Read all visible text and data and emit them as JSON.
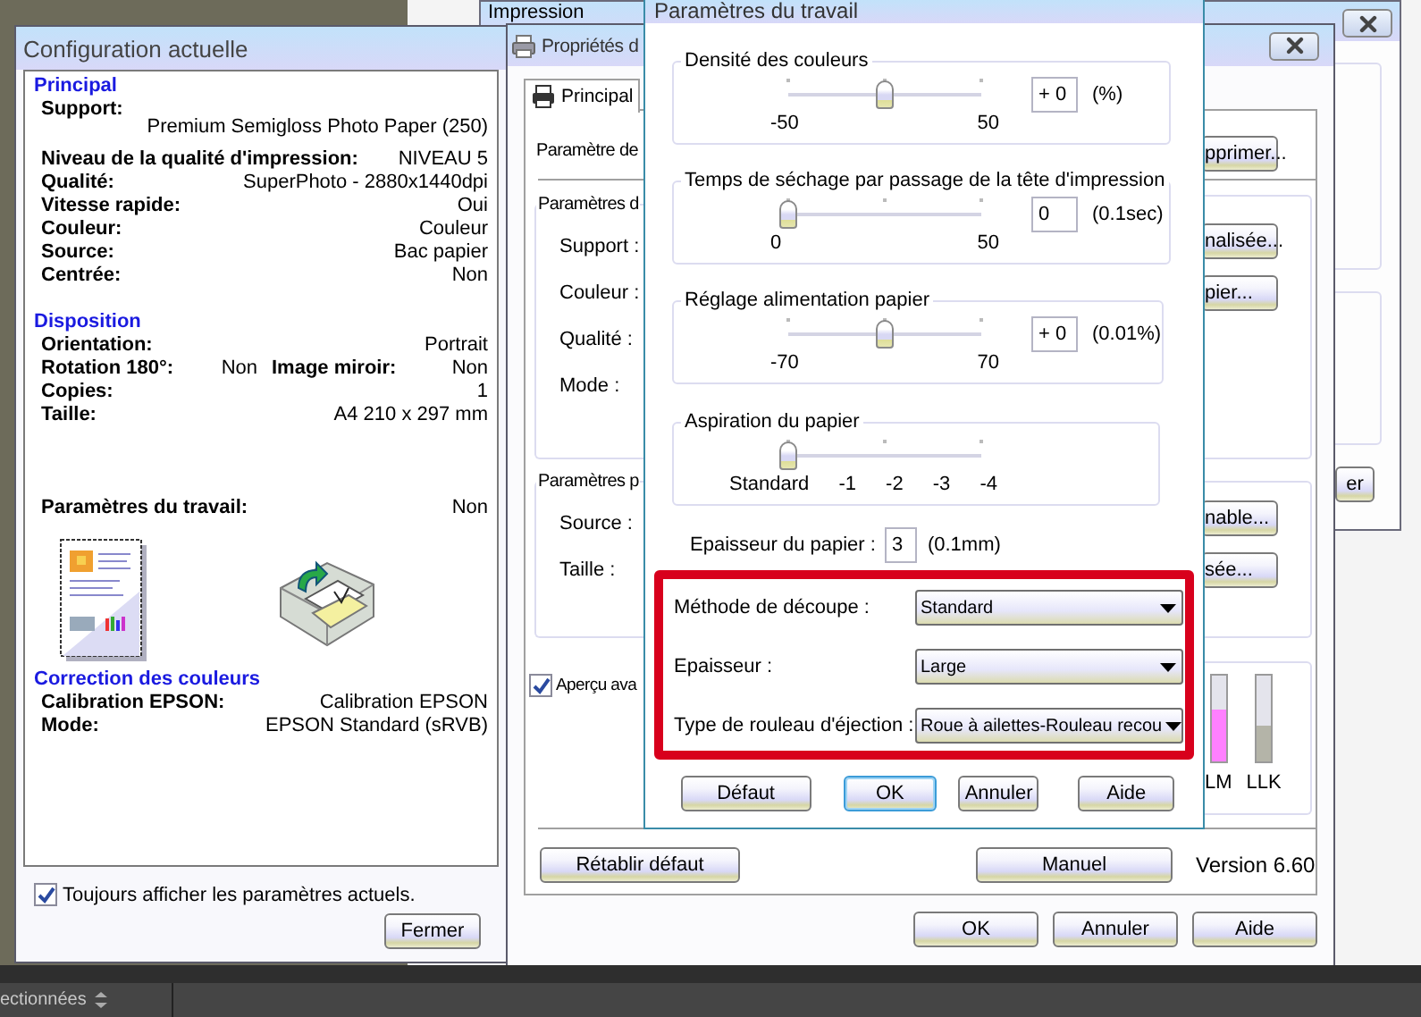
{
  "impression_window": {
    "title": "Impression",
    "button": "er"
  },
  "properties_window": {
    "title": "Propriétés d",
    "tabs": [
      {
        "label": "Principal",
        "selected": true
      }
    ],
    "heading": "Paramètre de",
    "groups": [
      {
        "title": "Paramètres d",
        "fields": [
          "Support :",
          "Couleur :",
          "Qualité :",
          "Mode :"
        ]
      },
      {
        "title": "Paramètres p",
        "fields": [
          "Source :",
          "Taille :"
        ]
      }
    ],
    "top_button": "pprimer...",
    "side_groups": [
      {
        "buttons": [
          "nalisée...",
          "pier..."
        ]
      },
      {
        "buttons": [
          "nable...",
          "sée..."
        ]
      }
    ],
    "preview_checkbox": {
      "label": "Aperçu ava",
      "checked": true
    },
    "ink_levels": [
      {
        "name": "LM",
        "color": "#ff80ff",
        "level": 0.6
      },
      {
        "name": "LLK",
        "color": "#b4b4a8",
        "level": 0.42
      }
    ],
    "reset_button": "Rétablir défaut",
    "manual_button": "Manuel",
    "version": "Version 6.60",
    "buttons": [
      "OK",
      "Annuler",
      "Aide"
    ]
  },
  "config_window": {
    "title": "Configuration actuelle",
    "blocks": [
      {
        "kind": "section",
        "heading": "Principal",
        "rows": [
          {
            "kind": "stacked",
            "label": "Support:",
            "line_2": "Premium Semigloss Photo Paper (250)"
          },
          {
            "kind": "inline",
            "label": "Niveau de la qualité d'impression:",
            "value": "NIVEAU 5"
          },
          {
            "kind": "inline",
            "label": "Qualité:",
            "value": "SuperPhoto - 2880x1440dpi"
          },
          {
            "kind": "inline",
            "label": "Vitesse rapide:",
            "value": "Oui"
          },
          {
            "kind": "inline",
            "label": "Couleur:",
            "value": "Couleur"
          },
          {
            "kind": "inline",
            "label": "Source:",
            "value": "Bac papier"
          },
          {
            "kind": "inline",
            "label": "Centrée:",
            "value": "Non"
          }
        ]
      },
      {
        "kind": "section",
        "heading": "Disposition",
        "rows": [
          {
            "kind": "inline",
            "label": "Orientation:",
            "value": "Portrait"
          },
          {
            "kind": "double",
            "label": "Rotation 180°:",
            "value": "Non",
            "label_2": "Image miroir:",
            "value_2": "Non"
          },
          {
            "kind": "inline",
            "label": "Copies:",
            "value": "1"
          },
          {
            "kind": "inline",
            "label": "Taille:",
            "value": "A4 210 x 297 mm"
          }
        ]
      },
      {
        "kind": "summary",
        "label": "Paramètres du travail:",
        "value": "Non"
      },
      {
        "kind": "section",
        "heading": "Correction des couleurs",
        "rows": [
          {
            "kind": "inline",
            "label": "Calibration EPSON:",
            "value": "Calibration EPSON"
          },
          {
            "kind": "inline",
            "label": "Mode:",
            "value": "EPSON Standard (sRVB)"
          }
        ]
      }
    ],
    "checkbox": {
      "label": "Toujours afficher les paramètres actuels.",
      "checked": true
    },
    "close_button": "Fermer"
  },
  "job_dialog": {
    "title": "Paramètres du travail",
    "sliders": [
      {
        "title": "Densité des couleurs",
        "level": 0.5,
        "scale": [
          "-50",
          "50"
        ],
        "value": "+ 0",
        "unit": "(%)"
      },
      {
        "title": "Temps de séchage par passage de la tête d'impression",
        "level": 0,
        "scale": [
          "0",
          "50"
        ],
        "value": "0",
        "unit": "(0.1sec)"
      },
      {
        "title": "Réglage alimentation papier",
        "level": 0.5,
        "scale": [
          "-70",
          "70"
        ],
        "value": "+ 0",
        "unit": "(0.01%)"
      },
      {
        "title": "Aspiration du papier",
        "level": 0,
        "scale": [
          "Standard",
          "-1",
          "-2",
          "-3",
          "-4"
        ]
      }
    ],
    "paper_thickness": {
      "label": "Epaisseur du papier :",
      "value": "3",
      "unit": "(0.1mm)"
    },
    "dropdowns": [
      {
        "label": "Méthode de découpe :",
        "value": "Standard"
      },
      {
        "label": "Epaisseur :",
        "value": "Large"
      },
      {
        "label": "Type de rouleau d'éjection :",
        "value": "Roue à ailettes-Rouleau recou"
      }
    ],
    "buttons": [
      {
        "label": "Défaut",
        "focused": false
      },
      {
        "label": "OK",
        "focused": true
      },
      {
        "label": "Annuler",
        "focused": false
      },
      {
        "label": "Aide",
        "focused": false
      }
    ]
  },
  "taskbar": {
    "text": "ectionnées"
  }
}
